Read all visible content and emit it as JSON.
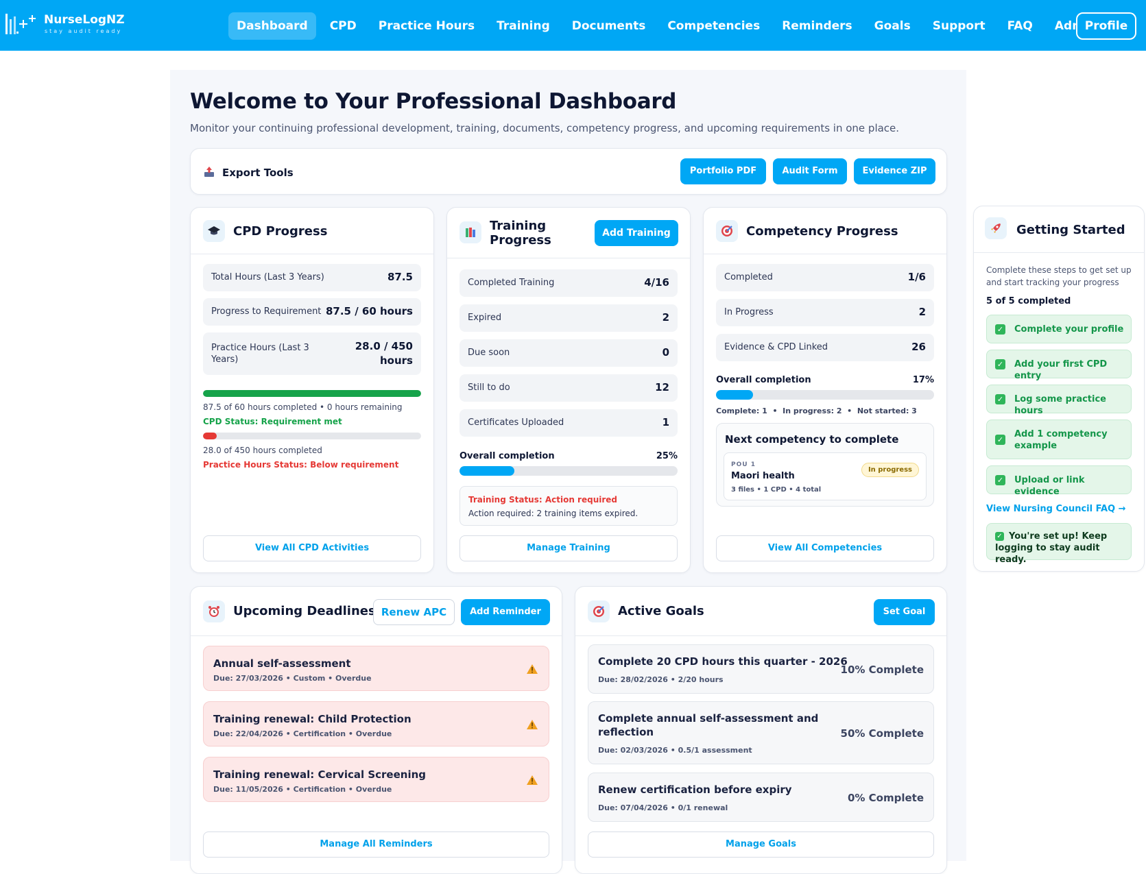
{
  "brand": {
    "name": "NurseLogNZ",
    "tagline": "stay audit ready"
  },
  "nav": {
    "items": [
      "Dashboard",
      "CPD",
      "Practice Hours",
      "Training",
      "Documents",
      "Competencies",
      "Reminders",
      "Goals",
      "Support",
      "FAQ",
      "Admin"
    ],
    "active": "Dashboard",
    "profile": "Profile"
  },
  "page": {
    "title": "Welcome to Your Professional Dashboard",
    "subtitle": "Monitor your continuing professional development, training, documents, competency progress, and upcoming requirements in one place."
  },
  "export": {
    "title": "Export Tools",
    "buttons": [
      "Portfolio PDF",
      "Audit Form",
      "Evidence ZIP"
    ]
  },
  "cpd": {
    "title": "CPD Progress",
    "stats": [
      {
        "label": "Total Hours (Last 3 Years)",
        "value": "87.5"
      },
      {
        "label": "Progress to Requirement",
        "value": "87.5 / 60 hours"
      },
      {
        "label": "Practice Hours (Last 3",
        "label2": "Years)",
        "value": "28.0 / 450",
        "value2": "hours"
      }
    ],
    "cpd_progress": 1.0,
    "cpd_summary": "87.5 of 60 hours completed • 0 hours remaining",
    "cpd_status": "CPD Status: Requirement met",
    "practice_progress": 0.062,
    "practice_summary": "28.0 of 450 hours completed",
    "practice_status": "Practice Hours Status: Below requirement",
    "button": "View All CPD Activities"
  },
  "training": {
    "title_line1": "Training",
    "title_line2": "Progress",
    "add_button": "Add Training",
    "stats": [
      {
        "label": "Completed Training",
        "value": "4/16"
      },
      {
        "label": "Expired",
        "value": "2"
      },
      {
        "label": "Due soon",
        "value": "0"
      },
      {
        "label": "Still to do",
        "value": "12"
      },
      {
        "label": "Certificates Uploaded",
        "value": "1"
      }
    ],
    "completion_label": "Overall completion",
    "completion_pct": "25%",
    "completion_value": 0.25,
    "status_title": "Training Status: Action required",
    "status_detail": "Action required: 2 training items expired.",
    "button": "Manage Training"
  },
  "competency": {
    "title": "Competency Progress",
    "stats": [
      {
        "label": "Completed",
        "value": "1/6"
      },
      {
        "label": "In Progress",
        "value": "2"
      },
      {
        "label": "Evidence & CPD Linked",
        "value": "26"
      }
    ],
    "completion_label": "Overall completion",
    "completion_pct": "17%",
    "completion_value": 0.17,
    "breakdown": "Complete: 1  •  In progress: 2  •  Not started: 3",
    "next_title": "Next competency to complete",
    "next_code": "POU 1",
    "next_name": "Maori health",
    "next_meta": "3 files • 1 CPD • 4 total",
    "next_badge": "In progress",
    "button": "View All Competencies"
  },
  "getting_started": {
    "title": "Getting Started",
    "desc_line1": "Complete these steps to get set up",
    "desc_line2": "and start tracking your progress",
    "count": "5 of 5 completed",
    "items": [
      "Complete your profile",
      "Add your first CPD entry",
      "Log some practice hours",
      "Add 1 competency",
      "Upload or link evidence"
    ],
    "item4_line2": "example",
    "faq_link": "View Nursing Council FAQ →",
    "done_line1": "You're set up! Keep",
    "done_line2": "logging to stay audit ready."
  },
  "deadlines": {
    "title": "Upcoming Deadlines",
    "renew_button": "Renew APC",
    "add_button": "Add Reminder",
    "items": [
      {
        "title": "Annual self-assessment",
        "meta": "Due: 27/03/2026 • Custom • Overdue"
      },
      {
        "title": "Training renewal: Child Protection",
        "meta": "Due: 22/04/2026 • Certification • Overdue"
      },
      {
        "title": "Training renewal: Cervical Screening",
        "meta": "Due: 11/05/2026 • Certification • Overdue"
      }
    ],
    "button": "Manage All Reminders"
  },
  "goals": {
    "title": "Active Goals",
    "set_button": "Set Goal",
    "items": [
      {
        "title": "Complete 20 CPD hours this quarter - 2026",
        "meta": "Due: 28/02/2026 • 2/20 hours",
        "pct": "10% Complete"
      },
      {
        "title": "Complete annual self-assessment and",
        "title2": "reflection",
        "meta": "Due: 02/03/2026 • 0.5/1 assessment",
        "pct": "50% Complete"
      },
      {
        "title": "Renew certification before expiry",
        "meta": "Due: 07/04/2026 • 0/1 renewal",
        "pct": "0% Complete"
      }
    ],
    "button": "Manage Goals"
  },
  "colors": {
    "primary": "#00a7f5",
    "success": "#16a34a",
    "danger": "#e53935"
  }
}
